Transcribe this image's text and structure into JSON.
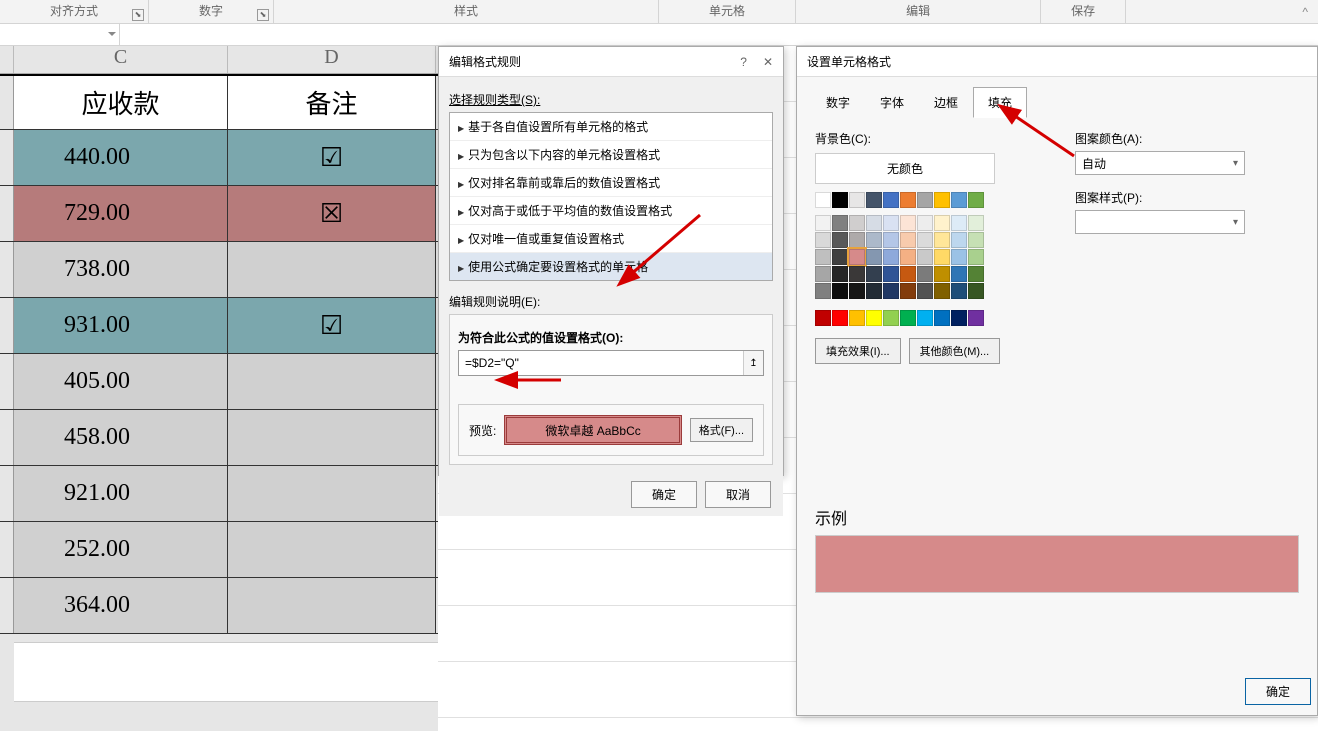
{
  "ribbon": {
    "groups": [
      "对齐方式",
      "数字",
      "样式",
      "单元格",
      "编辑",
      "保存"
    ]
  },
  "sheet": {
    "col_c": "C",
    "col_d": "D",
    "header_c": "应收款",
    "header_d": "备注",
    "rows": [
      {
        "c": "440.00",
        "d": "☑",
        "cls": "row-teal"
      },
      {
        "c": "729.00",
        "d": "☒",
        "cls": "row-rose"
      },
      {
        "c": "738.00",
        "d": "",
        "cls": "row-gray"
      },
      {
        "c": "931.00",
        "d": "☑",
        "cls": "row-teal"
      },
      {
        "c": "405.00",
        "d": "",
        "cls": "row-gray"
      },
      {
        "c": "458.00",
        "d": "",
        "cls": "row-gray"
      },
      {
        "c": "921.00",
        "d": "",
        "cls": "row-gray"
      },
      {
        "c": "252.00",
        "d": "",
        "cls": "row-gray"
      },
      {
        "c": "364.00",
        "d": "",
        "cls": "row-gray"
      }
    ]
  },
  "dlg1": {
    "title": "编辑格式规则",
    "label_type": "选择规则类型(S):",
    "rules": [
      "基于各自值设置所有单元格的格式",
      "只为包含以下内容的单元格设置格式",
      "仅对排名靠前或靠后的数值设置格式",
      "仅对高于或低于平均值的数值设置格式",
      "仅对唯一值或重复值设置格式",
      "使用公式确定要设置格式的单元格"
    ],
    "label_desc": "编辑规则说明(E):",
    "label_formula": "为符合此公式的值设置格式(O):",
    "formula": "=$D2=\"Q\"",
    "preview_label": "预览:",
    "preview_text": "微软卓越 AaBbCc",
    "format_btn": "格式(F)...",
    "ok": "确定",
    "cancel": "取消"
  },
  "dlg2": {
    "title": "设置单元格格式",
    "tabs": [
      "数字",
      "字体",
      "边框",
      "填充"
    ],
    "bg_label": "背景色(C):",
    "no_color": "无颜色",
    "fill_effects": "填充效果(I)...",
    "other_colors": "其他颜色(M)...",
    "pattern_color_label": "图案颜色(A):",
    "pattern_color_value": "自动",
    "pattern_style_label": "图案样式(P):",
    "sample_label": "示例",
    "ok": "确定"
  },
  "palette": {
    "theme1": [
      "#ffffff",
      "#000000",
      "#e7e6e6",
      "#44546a",
      "#4472c4",
      "#ed7d31",
      "#a5a5a5",
      "#ffc000",
      "#5b9bd5",
      "#70ad47"
    ],
    "shades": [
      [
        "#f2f2f2",
        "#808080",
        "#d0cece",
        "#d6dce5",
        "#d9e1f2",
        "#fce4d6",
        "#ededed",
        "#fff2cc",
        "#ddebf7",
        "#e2efda"
      ],
      [
        "#d9d9d9",
        "#595959",
        "#aeaaaa",
        "#acb9ca",
        "#b4c6e7",
        "#f8cbad",
        "#dbdbdb",
        "#ffe699",
        "#bdd7ee",
        "#c6e0b4"
      ],
      [
        "#bfbfbf",
        "#404040",
        "#d68a8a",
        "#8497b0",
        "#8ea9db",
        "#f4b084",
        "#c9c9c9",
        "#ffd966",
        "#9bc2e6",
        "#a9d08e"
      ],
      [
        "#a6a6a6",
        "#262626",
        "#3a3838",
        "#333f4f",
        "#305496",
        "#c65911",
        "#7b7b7b",
        "#bf8f00",
        "#2f75b5",
        "#548235"
      ],
      [
        "#808080",
        "#0d0d0d",
        "#161616",
        "#222b35",
        "#203764",
        "#833c0c",
        "#525252",
        "#806000",
        "#1f4e78",
        "#375623"
      ]
    ],
    "standard": [
      "#c00000",
      "#ff0000",
      "#ffc000",
      "#ffff00",
      "#92d050",
      "#00b050",
      "#00b0f0",
      "#0070c0",
      "#002060",
      "#7030a0"
    ]
  }
}
